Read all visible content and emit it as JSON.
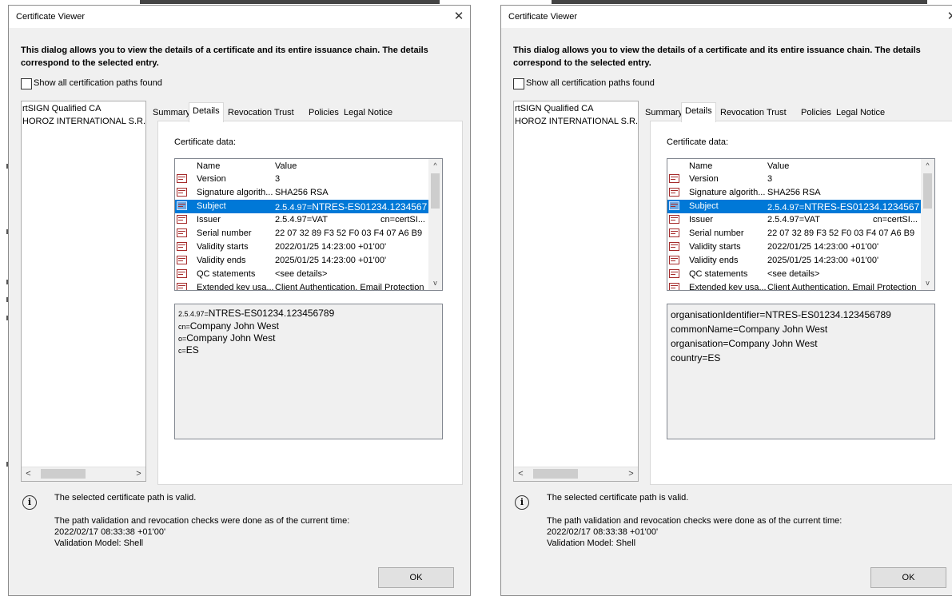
{
  "colors": {
    "dialog_bg": "#f0f0f0",
    "selection": "#0078d7",
    "panel": "#ffffff"
  },
  "icons": {
    "close": "close-icon",
    "info": "info-icon",
    "field": "certificate-field-icon",
    "scroll_left": "chevron-left-icon",
    "scroll_right": "chevron-right-icon",
    "scroll_up": "chevron-up-icon",
    "scroll_down": "chevron-down-icon"
  },
  "dialogs": [
    {
      "title": "Certificate Viewer",
      "close_glyph": "✕",
      "description": "This dialog allows you to view the details of a certificate and its entire issuance chain. The details correspond to the selected entry.",
      "show_all_label": "Show all certification paths found",
      "show_all_checked": false,
      "chain": [
        "rtSIGN Qualified CA",
        "HOROZ INTERNATIONAL S.R."
      ],
      "scroll_left_glyph": "<",
      "scroll_right_glyph": ">",
      "tabs": [
        "Summary",
        "Details",
        "Revocation",
        "Trust",
        "Policies",
        "Legal Notice"
      ],
      "active_tab": "Details",
      "cert_data_label": "Certificate data:",
      "columns": {
        "name": "Name",
        "value": "Value"
      },
      "fields": [
        {
          "name": "Version",
          "value": "3"
        },
        {
          "name": "Signature algorith...",
          "value": "SHA256 RSA"
        },
        {
          "name": "Subject",
          "value_prefix": "2.5.4.97=",
          "value_main": "NTRES-ES01234.1234567",
          "selected": true
        },
        {
          "name": "Issuer",
          "value": "2.5.4.97=VAT",
          "value_tail": "cn=certSI..."
        },
        {
          "name": "Serial number",
          "value": "22 07 32 89 F3 52 F0 03 F4 07 A6 B9"
        },
        {
          "name": "Validity starts",
          "value": "2022/01/25 14:23:00 +01'00'"
        },
        {
          "name": "Validity ends",
          "value": "2025/01/25 14:23:00 +01'00'"
        },
        {
          "name": "QC statements",
          "value": "<see details>"
        },
        {
          "name": "Extended key usa...",
          "value": "Client Authentication, Email Protection"
        }
      ],
      "scroll_up_glyph": "^",
      "scroll_down_glyph": "v",
      "detail": [
        {
          "prefix": "2.5.4.97=",
          "text": "NTRES-ES01234.123456789"
        },
        {
          "prefix": "cn=",
          "text": "Company John West"
        },
        {
          "prefix": "o=",
          "text": "Company John West"
        },
        {
          "prefix": "c=",
          "text": "ES"
        }
      ],
      "info_glyph": "i",
      "status_valid": "The selected certificate path is valid.",
      "validation_line1": "The path validation and revocation checks were done as of the current time:",
      "validation_line2": "2022/02/17 08:33:38 +01'00'",
      "validation_line3": "Validation Model: Shell",
      "ok_label": "OK"
    },
    {
      "title": "Certificate Viewer",
      "close_glyph": "✕",
      "description": "This dialog allows you to view the details of a certificate and its entire issuance chain. The details correspond to the selected entry.",
      "show_all_label": "Show all certification paths found",
      "show_all_checked": false,
      "chain": [
        "rtSIGN Qualified CA",
        "HOROZ INTERNATIONAL S.R."
      ],
      "scroll_left_glyph": "<",
      "scroll_right_glyph": ">",
      "tabs": [
        "Summary",
        "Details",
        "Revocation",
        "Trust",
        "Policies",
        "Legal Notice"
      ],
      "active_tab": "Details",
      "cert_data_label": "Certificate data:",
      "columns": {
        "name": "Name",
        "value": "Value"
      },
      "fields": [
        {
          "name": "Version",
          "value": "3"
        },
        {
          "name": "Signature algorith...",
          "value": "SHA256 RSA"
        },
        {
          "name": "Subject",
          "value_prefix": "2.5.4.97=",
          "value_main": "NTRES-ES01234.1234567",
          "selected": true
        },
        {
          "name": "Issuer",
          "value": "2.5.4.97=VAT",
          "value_tail": "cn=certSI..."
        },
        {
          "name": "Serial number",
          "value": "22 07 32 89 F3 52 F0 03 F4 07 A6 B9"
        },
        {
          "name": "Validity starts",
          "value": "2022/01/25 14:23:00 +01'00'"
        },
        {
          "name": "Validity ends",
          "value": "2025/01/25 14:23:00 +01'00'"
        },
        {
          "name": "QC statements",
          "value": "<see details>"
        },
        {
          "name": "Extended key usa...",
          "value": "Client Authentication, Email Protection"
        }
      ],
      "scroll_up_glyph": "^",
      "scroll_down_glyph": "v",
      "detail": [
        {
          "prefix": "",
          "text": "organisationIdentifier=NTRES-ES01234.123456789"
        },
        {
          "prefix": "",
          "text": "commonName=Company John West"
        },
        {
          "prefix": "",
          "text": "organisation=Company John West"
        },
        {
          "prefix": "",
          "text": "country=ES"
        }
      ],
      "info_glyph": "i",
      "status_valid": "The selected certificate path is valid.",
      "validation_line1": "The path validation and revocation checks were done as of the current time:",
      "validation_line2": "2022/02/17 08:33:38 +01'00'",
      "validation_line3": "Validation Model: Shell",
      "ok_label": "OK"
    }
  ]
}
